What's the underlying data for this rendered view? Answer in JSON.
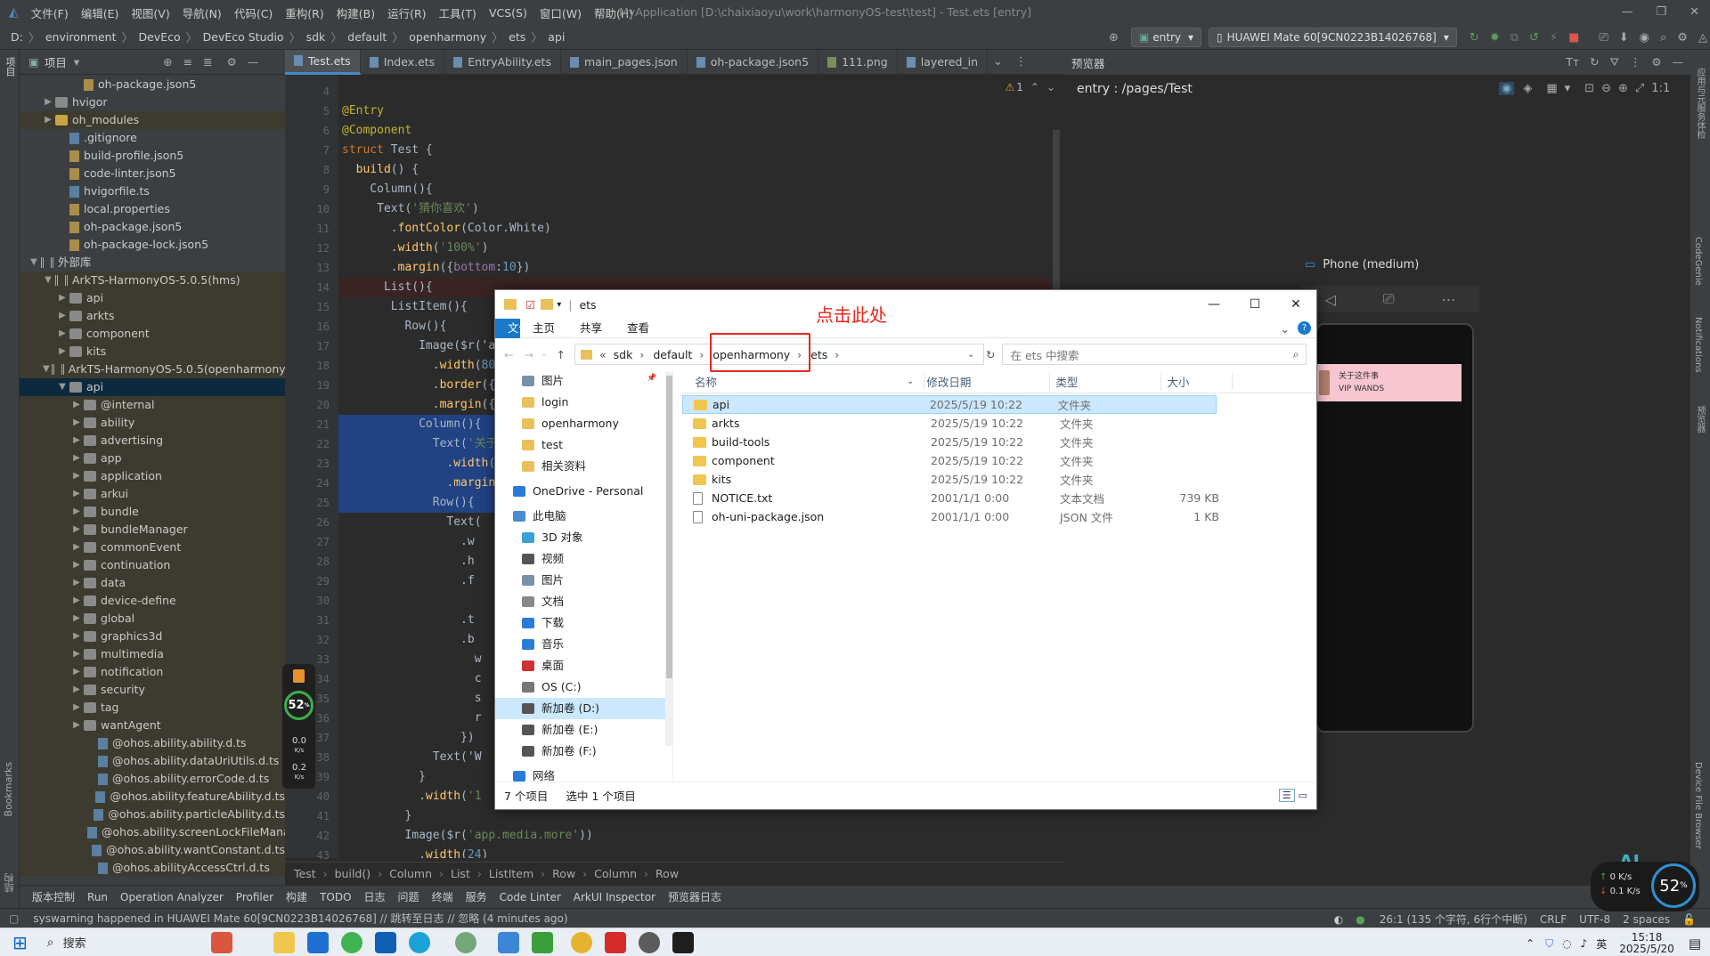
{
  "menubar": {
    "items": [
      "文件(F)",
      "编辑(E)",
      "视图(V)",
      "导航(N)",
      "代码(C)",
      "重构(R)",
      "构建(B)",
      "运行(R)",
      "工具(T)",
      "VCS(S)",
      "窗口(W)",
      "帮助(H)"
    ],
    "window_title": "MyApplication [D:\\chaixiaoyu\\work\\harmonyOS-test\\test] - Test.ets [entry]"
  },
  "navbar": {
    "crumbs": [
      "D:",
      "environment",
      "DevEco",
      "DevEco Studio",
      "sdk",
      "default",
      "openharmony",
      "ets",
      "api"
    ],
    "module_select": "entry",
    "device_select": "HUAWEI Mate 60[9CN0223B14026768]"
  },
  "left_strip": {
    "top_label": "项目",
    "bookmarks": "Bookmarks",
    "structure": "结构"
  },
  "project": {
    "header": "项目",
    "tree": [
      {
        "label": "oh-package.json5",
        "indent": 3,
        "type": "file"
      },
      {
        "label": "hvigor",
        "indent": 1,
        "type": "folder",
        "arrow": "▶"
      },
      {
        "label": "oh_modules",
        "indent": 1,
        "type": "folderY",
        "arrow": "▶",
        "hl": true
      },
      {
        "label": ".gitignore",
        "indent": 2,
        "type": "file"
      },
      {
        "label": "build-profile.json5",
        "indent": 2,
        "type": "file"
      },
      {
        "label": "code-linter.json5",
        "indent": 2,
        "type": "file"
      },
      {
        "label": "hvigorfile.ts",
        "indent": 2,
        "type": "file"
      },
      {
        "label": "local.properties",
        "indent": 2,
        "type": "file"
      },
      {
        "label": "oh-package.json5",
        "indent": 2,
        "type": "file"
      },
      {
        "label": "oh-package-lock.json5",
        "indent": 2,
        "type": "file"
      },
      {
        "label": "外部库",
        "indent": 0,
        "type": "lib",
        "arrow": "▼"
      },
      {
        "label": "ArkTS-HarmonyOS-5.0.5(hms)",
        "indent": 1,
        "type": "lib",
        "arrow": "▼",
        "hl": true
      },
      {
        "label": "api",
        "indent": 2,
        "type": "folder",
        "arrow": "▶",
        "hl": true
      },
      {
        "label": "arkts",
        "indent": 2,
        "type": "folder",
        "arrow": "▶",
        "hl": true
      },
      {
        "label": "component",
        "indent": 2,
        "type": "folder",
        "arrow": "▶",
        "hl": true
      },
      {
        "label": "kits",
        "indent": 2,
        "type": "folder",
        "arrow": "▶",
        "hl": true
      },
      {
        "label": "ArkTS-HarmonyOS-5.0.5(openharmony)",
        "indent": 1,
        "type": "lib",
        "arrow": "▼",
        "hl": true
      },
      {
        "label": "api",
        "indent": 2,
        "type": "folder",
        "arrow": "▼",
        "sel": true
      },
      {
        "label": "@internal",
        "indent": 3,
        "type": "folder",
        "arrow": "▶",
        "hl": true
      },
      {
        "label": "ability",
        "indent": 3,
        "type": "folder",
        "arrow": "▶",
        "hl": true
      },
      {
        "label": "advertising",
        "indent": 3,
        "type": "folder",
        "arrow": "▶",
        "hl": true
      },
      {
        "label": "app",
        "indent": 3,
        "type": "folder",
        "arrow": "▶",
        "hl": true
      },
      {
        "label": "application",
        "indent": 3,
        "type": "folder",
        "arrow": "▶",
        "hl": true
      },
      {
        "label": "arkui",
        "indent": 3,
        "type": "folder",
        "arrow": "▶",
        "hl": true
      },
      {
        "label": "bundle",
        "indent": 3,
        "type": "folder",
        "arrow": "▶",
        "hl": true
      },
      {
        "label": "bundleManager",
        "indent": 3,
        "type": "folder",
        "arrow": "▶",
        "hl": true
      },
      {
        "label": "commonEvent",
        "indent": 3,
        "type": "folder",
        "arrow": "▶",
        "hl": true
      },
      {
        "label": "continuation",
        "indent": 3,
        "type": "folder",
        "arrow": "▶",
        "hl": true
      },
      {
        "label": "data",
        "indent": 3,
        "type": "folder",
        "arrow": "▶",
        "hl": true
      },
      {
        "label": "device-define",
        "indent": 3,
        "type": "folder",
        "arrow": "▶",
        "hl": true
      },
      {
        "label": "global",
        "indent": 3,
        "type": "folder",
        "arrow": "▶",
        "hl": true
      },
      {
        "label": "graphics3d",
        "indent": 3,
        "type": "folder",
        "arrow": "▶",
        "hl": true
      },
      {
        "label": "multimedia",
        "indent": 3,
        "type": "folder",
        "arrow": "▶",
        "hl": true
      },
      {
        "label": "notification",
        "indent": 3,
        "type": "folder",
        "arrow": "▶",
        "hl": true
      },
      {
        "label": "security",
        "indent": 3,
        "type": "folder",
        "arrow": "▶",
        "hl": true
      },
      {
        "label": "tag",
        "indent": 3,
        "type": "folder",
        "arrow": "▶",
        "hl": true
      },
      {
        "label": "wantAgent",
        "indent": 3,
        "type": "folder",
        "arrow": "▶",
        "hl": true
      },
      {
        "label": "@ohos.ability.ability.d.ts",
        "indent": 4,
        "type": "file",
        "hl": true
      },
      {
        "label": "@ohos.ability.dataUriUtils.d.ts",
        "indent": 4,
        "type": "file",
        "hl": true
      },
      {
        "label": "@ohos.ability.errorCode.d.ts",
        "indent": 4,
        "type": "file",
        "hl": true
      },
      {
        "label": "@ohos.ability.featureAbility.d.ts",
        "indent": 4,
        "type": "file",
        "hl": true
      },
      {
        "label": "@ohos.ability.particleAbility.d.ts",
        "indent": 4,
        "type": "file",
        "hl": true
      },
      {
        "label": "@ohos.ability.screenLockFileManager.d.ts",
        "indent": 4,
        "type": "file",
        "hl": true
      },
      {
        "label": "@ohos.ability.wantConstant.d.ts",
        "indent": 4,
        "type": "file",
        "hl": true
      },
      {
        "label": "@ohos.abilityAccessCtrl.d.ts",
        "indent": 4,
        "type": "file",
        "hl": true
      }
    ]
  },
  "editor": {
    "tabs": [
      "Test.ets",
      "Index.ets",
      "EntryAbility.ets",
      "main_pages.json",
      "oh-package.json5",
      "111.png",
      "layered_in"
    ],
    "warning_count": "1",
    "lines": [
      {
        "n": "4",
        "c": ""
      },
      {
        "n": "5",
        "c": "<span class='an'>@Entry</span>"
      },
      {
        "n": "6",
        "c": "<span class='an'>@Component</span>"
      },
      {
        "n": "7",
        "c": "<span class='kw'>struct</span> Test {"
      },
      {
        "n": "8",
        "c": "  <span class='fn'>build</span>() {"
      },
      {
        "n": "9",
        "c": "    Column(){"
      },
      {
        "n": "10",
        "c": "     Text(<span class='st'>'猜你喜欢'</span>)"
      },
      {
        "n": "11",
        "c": "       .<span class='fn'>fontColor</span>(Color.White)"
      },
      {
        "n": "12",
        "c": "       .<span class='fn'>width</span>(<span class='st'>'100%'</span>)"
      },
      {
        "n": "13",
        "c": "       .<span class='fn'>margin</span>({<span class='pr'>bottom</span>:<span class='nm'>10</span>})"
      },
      {
        "n": "14",
        "c": "      List(){",
        "bp": true
      },
      {
        "n": "15",
        "c": "       ListItem(){"
      },
      {
        "n": "16",
        "c": "         Row(){"
      },
      {
        "n": "17",
        "c": "           Image($r('app.media.d"
      },
      {
        "n": "18",
        "c": "             .<span class='fn'>width</span>(<span class='nm'>80</span>"
      },
      {
        "n": "19",
        "c": "             .<span class='fn'>border</span>({"
      },
      {
        "n": "20",
        "c": "             .<span class='fn'>margin</span>({"
      },
      {
        "n": "21",
        "c": "           Column(){",
        "sel": true
      },
      {
        "n": "22",
        "c": "             Text(<span class='st'>'关于</span>",
        "sel": true
      },
      {
        "n": "23",
        "c": "               .<span class='fn'>width</span>(",
        "sel": true
      },
      {
        "n": "24",
        "c": "               .<span class='fn'>margin</span>",
        "sel": true
      },
      {
        "n": "25",
        "c": "             Row(){",
        "sel": true
      },
      {
        "n": "26",
        "c": "               Text("
      },
      {
        "n": "27",
        "c": "                 .w"
      },
      {
        "n": "28",
        "c": "                 .h"
      },
      {
        "n": "29",
        "c": "                 .f"
      },
      {
        "n": "30",
        "c": ""
      },
      {
        "n": "31",
        "c": "                 .t"
      },
      {
        "n": "32",
        "c": "                 .b"
      },
      {
        "n": "33",
        "c": "                   w"
      },
      {
        "n": "34",
        "c": "                   c"
      },
      {
        "n": "35",
        "c": "                   s"
      },
      {
        "n": "36",
        "c": "                   r"
      },
      {
        "n": "37",
        "c": "                 })"
      },
      {
        "n": "38",
        "c": "             Text('W"
      },
      {
        "n": "39",
        "c": "           }"
      },
      {
        "n": "40",
        "c": "           .<span class='fn'>width</span>(<span class='st'>'1</span>"
      },
      {
        "n": "41",
        "c": "         }"
      },
      {
        "n": "42",
        "c": "         Image($r(<span class='st'>'app.media.more'</span>))"
      },
      {
        "n": "43",
        "c": "           .<span class='fn'>width</span>(<span class='nm'>24</span>)"
      }
    ],
    "breadcrumb": [
      "Test",
      "build()",
      "Column",
      "List",
      "ListItem",
      "Row",
      "Column",
      "Row"
    ]
  },
  "preview": {
    "tool_label": "预览器",
    "path": "entry : /pages/Test",
    "device_label": "Phone (medium)",
    "card_title": "关于这件事",
    "card_sub": "VIP WANDS"
  },
  "right_strip": {
    "labels": [
      "应用与元服务体检",
      "CodeGenie",
      "Notifications",
      "预览器",
      "Device File Browser"
    ]
  },
  "bottom_tools": [
    "版本控制",
    "Run",
    "Operation Analyzer",
    "Profiler",
    "构建",
    "TODO",
    "日志",
    "问题",
    "终端",
    "服务",
    "Code Linter",
    "ArkUI Inspector",
    "预览器日志"
  ],
  "status": {
    "message": "syswarning happened in HUAWEI Mate 60[9CN0223B14026768] // 跳转至日志 // 忽略 (4 minutes ago)",
    "position": "26:1 (135 个字符, 6行个中断)",
    "line_sep": "CRLF",
    "encoding": "UTF-8",
    "indent": "2 spaces"
  },
  "explorer": {
    "title": "ets",
    "ribbon": [
      "文件",
      "主页",
      "共享",
      "查看"
    ],
    "address": [
      "sdk",
      "default",
      "openharmony",
      "ets"
    ],
    "search_placeholder": "在 ets 中搜索",
    "nav": [
      {
        "label": "图片",
        "c": "#7a8fa8"
      },
      {
        "label": "login",
        "c": "#e8c15b"
      },
      {
        "label": "openharmony",
        "c": "#e8c15b"
      },
      {
        "label": "test",
        "c": "#e8c15b"
      },
      {
        "label": "相关资料",
        "c": "#e8c15b"
      },
      {
        "label": "OneDrive - Personal",
        "c": "#2a7bd8",
        "top": true
      },
      {
        "label": "此电脑",
        "c": "#4a8ad0",
        "top": true
      },
      {
        "label": "3D 对象",
        "c": "#3ca0d8"
      },
      {
        "label": "视频",
        "c": "#555"
      },
      {
        "label": "图片",
        "c": "#7a8fa8"
      },
      {
        "label": "文档",
        "c": "#888"
      },
      {
        "label": "下载",
        "c": "#2a7bd8"
      },
      {
        "label": "音乐",
        "c": "#2a7bd8"
      },
      {
        "label": "桌面",
        "c": "#c33"
      },
      {
        "label": "OS (C:)",
        "c": "#777"
      },
      {
        "label": "新加卷 (D:)",
        "c": "#555",
        "sel": true
      },
      {
        "label": "新加卷 (E:)",
        "c": "#555"
      },
      {
        "label": "新加卷 (F:)",
        "c": "#555"
      },
      {
        "label": "网络",
        "c": "#2a7bd8",
        "top": true
      }
    ],
    "columns": [
      "名称",
      "修改日期",
      "类型",
      "大小"
    ],
    "files": [
      {
        "name": "api",
        "date": "2025/5/19 10:22",
        "type": "文件夹",
        "size": "",
        "kind": "folder",
        "sel": true
      },
      {
        "name": "arkts",
        "date": "2025/5/19 10:22",
        "type": "文件夹",
        "size": "",
        "kind": "folder"
      },
      {
        "name": "build-tools",
        "date": "2025/5/19 10:22",
        "type": "文件夹",
        "size": "",
        "kind": "folder"
      },
      {
        "name": "component",
        "date": "2025/5/19 10:22",
        "type": "文件夹",
        "size": "",
        "kind": "folder"
      },
      {
        "name": "kits",
        "date": "2025/5/19 10:22",
        "type": "文件夹",
        "size": "",
        "kind": "folder"
      },
      {
        "name": "NOTICE.txt",
        "date": "2001/1/1 0:00",
        "type": "文本文档",
        "size": "739 KB",
        "kind": "txt"
      },
      {
        "name": "oh-uni-package.json",
        "date": "2001/1/1 0:00",
        "type": "JSON 文件",
        "size": "1 KB",
        "kind": "json"
      }
    ],
    "status_count": "7 个项目",
    "status_sel": "选中 1 个项目"
  },
  "annotation": {
    "text": "点击此处"
  },
  "gauge": {
    "percent": "52",
    "unit": "%",
    "up": "0.0",
    "down": "0.2",
    "rate_unit": "K/s"
  },
  "netbadge": {
    "up": "0 K/s",
    "down": "0.1 K/s",
    "percent": "52",
    "percent_sign": "%",
    "ai_label": "AI"
  },
  "taskbar": {
    "search": "搜索",
    "time": "15:18",
    "date": "2025/5/20",
    "ime": "英"
  },
  "colors": {
    "accent": "#4a88c7",
    "annotation": "#e8261d",
    "explorer_accent": "#1979ca"
  }
}
